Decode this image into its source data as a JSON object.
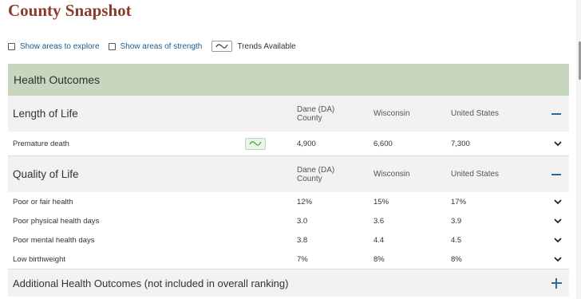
{
  "page": {
    "title": "County Snapshot"
  },
  "filters": {
    "show_explore": "Show areas to explore",
    "show_strength": "Show areas of strength",
    "trends_available": "Trends Available"
  },
  "outcomes": {
    "header": "Health Outcomes"
  },
  "length_of_life": {
    "title": "Length of Life",
    "columns": {
      "dane": "Dane (DA) County",
      "wisconsin": "Wisconsin",
      "us": "United States"
    },
    "rows": [
      {
        "label": "Premature death",
        "dane": "4,900",
        "wisconsin": "6,600",
        "us": "7,300"
      }
    ]
  },
  "quality_of_life": {
    "title": "Quality of Life",
    "columns": {
      "dane": "Dane (DA) County",
      "wisconsin": "Wisconsin",
      "us": "United States"
    },
    "rows": [
      {
        "label": "Poor or fair health",
        "dane": "12%",
        "wisconsin": "15%",
        "us": "17%"
      },
      {
        "label": "Poor physical health days",
        "dane": "3.0",
        "wisconsin": "3.6",
        "us": "3.9"
      },
      {
        "label": "Poor mental health days",
        "dane": "3.8",
        "wisconsin": "4.4",
        "us": "4.5"
      },
      {
        "label": "Low birthweight",
        "dane": "7%",
        "wisconsin": "8%",
        "us": "8%"
      }
    ]
  },
  "additional": {
    "title": "Additional Health Outcomes (not included in overall ranking)"
  },
  "icons": {
    "trend": "trend-line-icon",
    "collapse": "minus-icon",
    "expand": "plus-icon",
    "row_toggle": "chevron-down-icon"
  },
  "colors": {
    "title": "#8b3a2e",
    "outcomes_bg": "#c7d6bf",
    "section_bg": "#f2f2f2",
    "accent": "#2a6aa0",
    "link": "#1f5c8a"
  }
}
